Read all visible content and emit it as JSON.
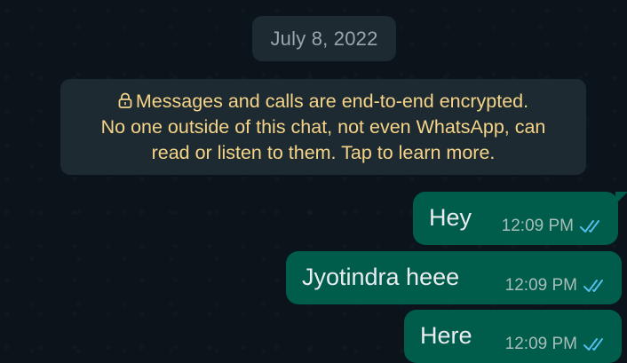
{
  "chat": {
    "date_chip": "July 8, 2022",
    "encryption_notice": {
      "line1": "Messages and calls are end-to-end encrypted.",
      "line2": "No one outside of this chat, not even WhatsApp, can",
      "line3": "read or listen to them. Tap to learn more.",
      "icon": "lock-icon"
    },
    "messages": [
      {
        "text": "Hey",
        "time": "12:09 PM",
        "status": "read",
        "icon": "double-check-icon"
      },
      {
        "text": "Jyotindra heee",
        "time": "12:09 PM",
        "status": "read",
        "icon": "double-check-icon"
      },
      {
        "text": "Here",
        "time": "12:09 PM",
        "status": "read",
        "icon": "double-check-icon"
      }
    ]
  },
  "colors": {
    "background": "#0b141a",
    "system_chip": "#1d2a32",
    "encryption_text": "#f5d488",
    "outgoing_bubble": "#005c4b",
    "read_tick": "#53bdeb"
  }
}
